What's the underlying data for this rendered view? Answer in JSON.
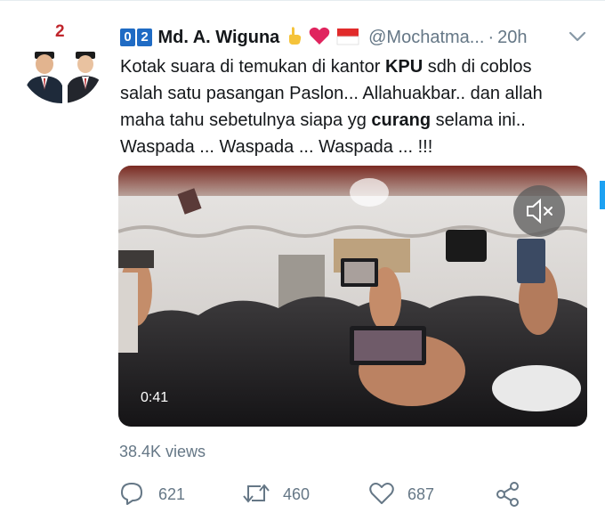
{
  "author": {
    "name": "Md. A. Wiguna",
    "badges": [
      "0",
      "2"
    ],
    "emojis": [
      "pointing-finger-icon",
      "heart-icon",
      "indonesia-flag-icon"
    ],
    "handle": "@Mochatma...",
    "separator": "·",
    "time": "20h",
    "avatar_number": "2"
  },
  "tweet": {
    "line1_pre": "Kotak suara di temukan di kantor ",
    "line1_bold": "KPU",
    "line1_post": " sdh di coblos",
    "line2": "salah satu pasangan Paslon... Allahuakbar.. dan allah",
    "line3_pre": "maha tahu sebetulnya siapa yg ",
    "line3_bold": "curang",
    "line3_post": " selama ini..",
    "line4": "Waspada ... Waspada ... Waspada ... !!!"
  },
  "video": {
    "duration": "0:41",
    "muted": true
  },
  "stats": {
    "views": "38.4K views",
    "replies": "621",
    "retweets": "460",
    "likes": "687"
  },
  "colors": {
    "accent": "#1da1f2",
    "muted_text": "#657786",
    "badge": "#1f6bc4",
    "heart": "#e0245e"
  }
}
